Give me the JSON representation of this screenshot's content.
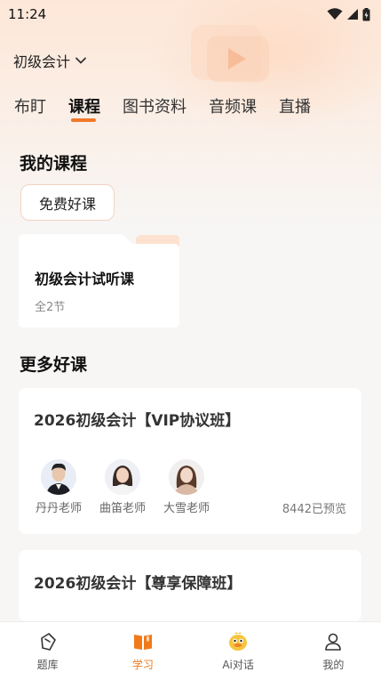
{
  "status_bar": {
    "time": "11:24"
  },
  "header": {
    "exam_selector": "初级会计",
    "tabs": [
      {
        "label": "布盯"
      },
      {
        "label": "课程"
      },
      {
        "label": "图书资料"
      },
      {
        "label": "音频课"
      },
      {
        "label": "直播"
      }
    ]
  },
  "my_courses": {
    "title": "我的课程",
    "chip": "免费好课",
    "folder": {
      "title": "初级会计试听课",
      "subtitle": "全2节"
    }
  },
  "more_courses": {
    "title": "更多好课",
    "cards": [
      {
        "title": "2026初级会计【VIP协议班】",
        "teachers": [
          "丹丹老师",
          "曲笛老师",
          "大雪老师"
        ],
        "preview_count": "8442已预览"
      },
      {
        "title": "2026初级会计【尊享保障班】"
      }
    ]
  },
  "bottom_nav": [
    {
      "label": "题库",
      "icon": "question-bank-icon"
    },
    {
      "label": "学习",
      "icon": "book-icon"
    },
    {
      "label": "Ai对话",
      "icon": "ai-duck-icon"
    },
    {
      "label": "我的",
      "icon": "profile-icon"
    }
  ],
  "colors": {
    "accent": "#f07a2a",
    "background": "#f7f6f5"
  }
}
